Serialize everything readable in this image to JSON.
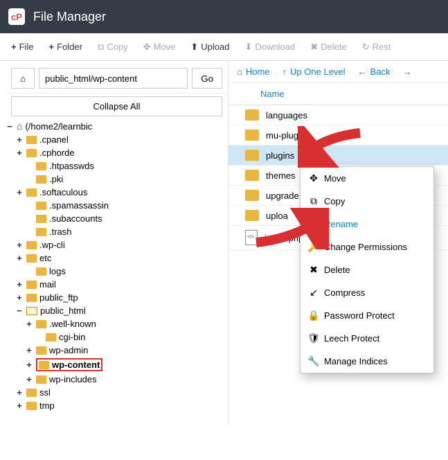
{
  "header": {
    "app_title": "File Manager"
  },
  "toolbar": {
    "file": "File",
    "folder": "Folder",
    "copy": "Copy",
    "move": "Move",
    "upload": "Upload",
    "download": "Download",
    "delete": "Delete",
    "restore": "Rest"
  },
  "location": {
    "path": "public_html/wp-content",
    "go": "Go",
    "collapse_all": "Collapse All"
  },
  "tree": {
    "root": "(/home2/learnbic",
    "items": [
      {
        "exp": "+",
        "label": ".cpanel",
        "lvl": 1
      },
      {
        "exp": "+",
        "label": ".cphorde",
        "lvl": 1
      },
      {
        "exp": "",
        "label": ".htpasswds",
        "lvl": 2
      },
      {
        "exp": "",
        "label": ".pki",
        "lvl": 2
      },
      {
        "exp": "+",
        "label": ".softaculous",
        "lvl": 1
      },
      {
        "exp": "",
        "label": ".spamassassin",
        "lvl": 2
      },
      {
        "exp": "",
        "label": ".subaccounts",
        "lvl": 2
      },
      {
        "exp": "",
        "label": ".trash",
        "lvl": 2
      },
      {
        "exp": "+",
        "label": ".wp-cli",
        "lvl": 1
      },
      {
        "exp": "+",
        "label": "etc",
        "lvl": 1
      },
      {
        "exp": "",
        "label": "logs",
        "lvl": 2
      },
      {
        "exp": "+",
        "label": "mail",
        "lvl": 1
      },
      {
        "exp": "+",
        "label": "public_ftp",
        "lvl": 1
      },
      {
        "exp": "−",
        "label": "public_html",
        "lvl": 1,
        "open": true
      },
      {
        "exp": "+",
        "label": ".well-known",
        "lvl": 2
      },
      {
        "exp": "",
        "label": "cgi-bin",
        "lvl": 3
      },
      {
        "exp": "+",
        "label": "wp-admin",
        "lvl": 2
      },
      {
        "exp": "+",
        "label": "wp-content",
        "lvl": 2,
        "sel": true
      },
      {
        "exp": "+",
        "label": "wp-includes",
        "lvl": 2
      },
      {
        "exp": "+",
        "label": "ssl",
        "lvl": 1
      },
      {
        "exp": "+",
        "label": "tmp",
        "lvl": 1
      }
    ]
  },
  "nav": {
    "home": "Home",
    "up": "Up One Level",
    "back": "Back",
    "forward": ""
  },
  "columns": {
    "name": "Name"
  },
  "files": [
    {
      "name": "languages",
      "type": "folder"
    },
    {
      "name": "mu-plugins",
      "type": "folder"
    },
    {
      "name": "plugins",
      "type": "folder",
      "selected": true
    },
    {
      "name": "themes",
      "type": "folder"
    },
    {
      "name": "upgrade",
      "type": "folder"
    },
    {
      "name": "uploa",
      "type": "folder"
    },
    {
      "name": "index.php",
      "type": "file"
    }
  ],
  "context_menu": [
    {
      "icon": "✥",
      "label": "Move"
    },
    {
      "icon": "⧉",
      "label": "Copy"
    },
    {
      "icon": "▮",
      "label": "Rename",
      "active": true
    },
    {
      "icon": "🔑",
      "label": "Change Permissions"
    },
    {
      "icon": "✖",
      "label": "Delete"
    },
    {
      "icon": "↙",
      "label": "Compress"
    },
    {
      "icon": "🔒",
      "label": "Password Protect"
    },
    {
      "icon": "🛡",
      "label": "Leech Protect"
    },
    {
      "icon": "🔧",
      "label": "Manage Indices"
    }
  ]
}
